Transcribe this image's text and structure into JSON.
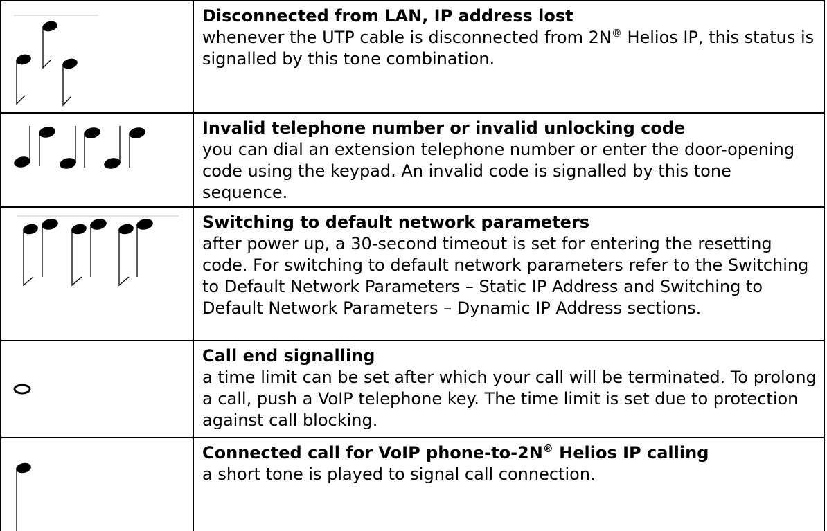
{
  "rows": [
    {
      "icon": "three-notes-falling-icon",
      "title_before": "Disconnected from LAN, IP address lost",
      "title_sup": "",
      "title_after": "",
      "desc_before": "whenever the UTP cable is disconnected from 2N",
      "desc_sup": "®",
      "desc_after": " Helios IP, this status is signalled by this tone combination."
    },
    {
      "icon": "six-notes-alternating-icon",
      "title_before": "Invalid telephone number or invalid unlocking code",
      "title_sup": "",
      "title_after": "",
      "desc_before": "you can dial an extension telephone number or enter the door-opening code using the keypad. An invalid code is signalled by this tone sequence.",
      "desc_sup": "",
      "desc_after": ""
    },
    {
      "icon": "six-notes-rising-icon",
      "title_before": "Switching to default network parameters",
      "title_sup": "",
      "title_after": "",
      "desc_before": "after power up, a 30-second timeout is set for entering the resetting code. For switching to default network parameters refer to the Switching to Default Network Parameters – Static IP Address and Switching to Default Network Parameters – Dynamic IP Address sections.",
      "desc_sup": "",
      "desc_after": ""
    },
    {
      "icon": "whole-note-icon",
      "title_before": "Call end signalling",
      "title_sup": "",
      "title_after": "",
      "desc_before": "a time limit can be set after which your call will be terminated. To prolong a call, push a VoIP telephone key. The time limit is set due to protection against call blocking.",
      "desc_sup": "",
      "desc_after": ""
    },
    {
      "icon": "single-note-icon",
      "title_before": "Connected call for VoIP phone-to-2N",
      "title_sup": "®",
      "title_after": " Helios IP calling",
      "desc_before": "a short tone is played to signal call connection.",
      "desc_sup": "",
      "desc_after": ""
    }
  ]
}
